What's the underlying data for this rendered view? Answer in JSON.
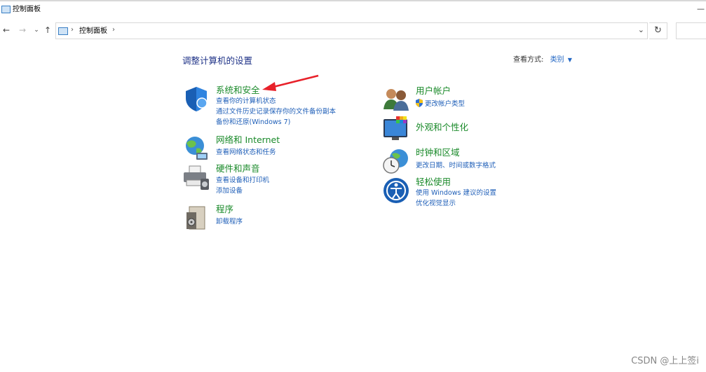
{
  "window": {
    "title": "控制面板",
    "minimize": "—"
  },
  "nav": {
    "back": "←",
    "forward": "→",
    "recent": "⌄",
    "up": "↑"
  },
  "address": {
    "sep1": "›",
    "crumb": "控制面板",
    "sep2": "›",
    "dropdown": "⌄",
    "refresh": "↻"
  },
  "main": {
    "heading": "调整计算机的设置",
    "view_label": "查看方式:",
    "view_value": "类别",
    "view_arrow": "▼"
  },
  "categories": {
    "system_security": {
      "title": "系统和安全",
      "links": [
        "查看你的计算机状态",
        "通过文件历史记录保存你的文件备份副本",
        "备份和还原(Windows 7)"
      ]
    },
    "network": {
      "title": "网络和 Internet",
      "links": [
        "查看网络状态和任务"
      ]
    },
    "hardware": {
      "title": "硬件和声音",
      "links": [
        "查看设备和打印机",
        "添加设备"
      ]
    },
    "programs": {
      "title": "程序",
      "links": [
        "卸载程序"
      ]
    },
    "user_accounts": {
      "title": "用户帐户",
      "links": [
        "更改帐户类型"
      ]
    },
    "appearance": {
      "title": "外观和个性化",
      "links": []
    },
    "clock_region": {
      "title": "时钟和区域",
      "links": [
        "更改日期、时间或数字格式"
      ]
    },
    "ease_access": {
      "title": "轻松使用",
      "links": [
        "使用 Windows 建议的设置",
        "优化视觉显示"
      ]
    }
  },
  "watermark": "CSDN @上上签i",
  "colors": {
    "heading": "#1e3287",
    "category_title": "#1a8a2a",
    "link": "#1f5fb8",
    "annotation_arrow": "#e8212a"
  }
}
